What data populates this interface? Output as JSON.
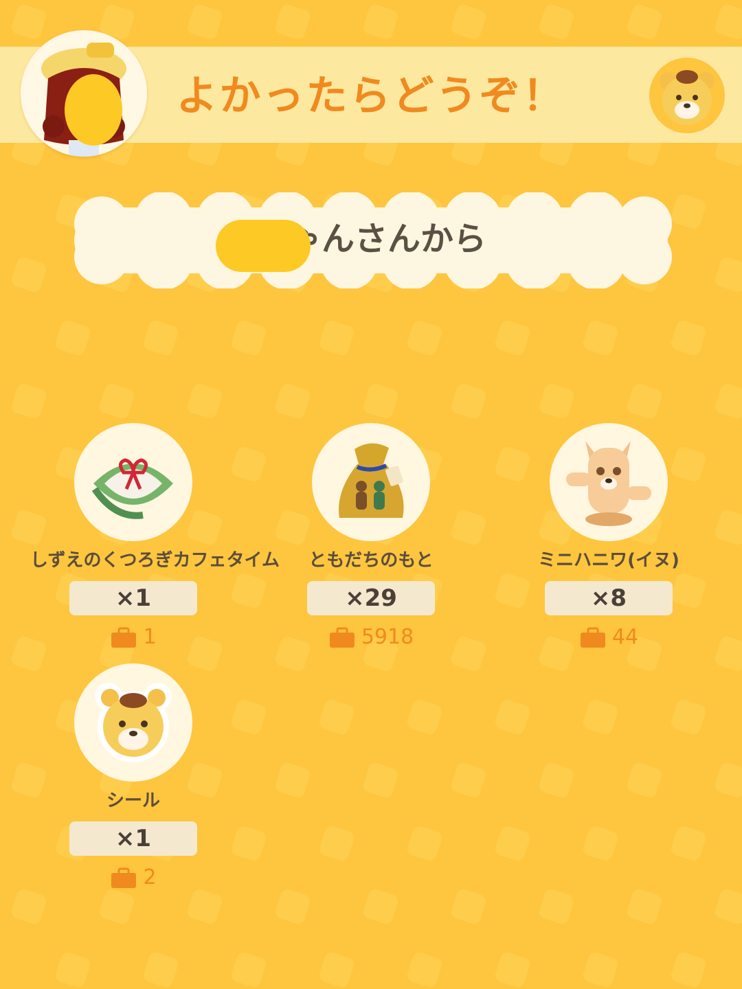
{
  "header": {
    "title": "よかったらどうぞ！"
  },
  "sender": {
    "label": "ちゃんさんから"
  },
  "items": [
    {
      "name": "しずえのくつろぎカフェタイム",
      "qty": "×1",
      "owned": "1",
      "icon": "gift-box-icon"
    },
    {
      "name": "ともだちのもと",
      "qty": "×29",
      "owned": "5918",
      "icon": "friend-bag-icon"
    },
    {
      "name": "ミニハニワ(イヌ)",
      "qty": "×8",
      "owned": "44",
      "icon": "haniwa-dog-icon"
    },
    {
      "name": "シール",
      "qty": "×1",
      "owned": "2",
      "icon": "bear-sticker-icon"
    }
  ],
  "colors": {
    "background": "#fec53e",
    "title": "#f08a1e",
    "banner": "#fdf6e1",
    "count": "#f08a1e"
  }
}
